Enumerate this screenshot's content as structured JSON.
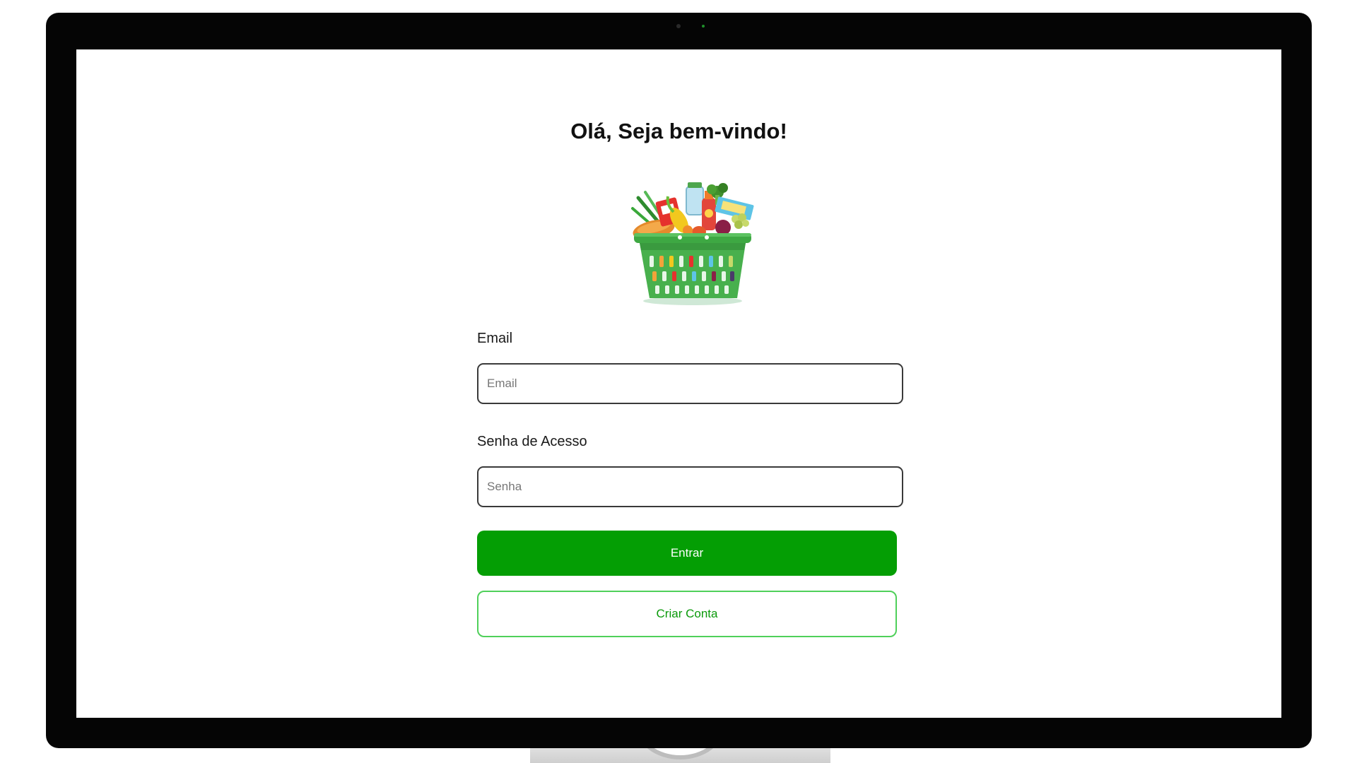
{
  "page": {
    "title": "Olá, Seja bem-vindo!",
    "logo_icon": "grocery-basket-icon"
  },
  "form": {
    "email": {
      "label": "Email",
      "placeholder": "Email",
      "value": ""
    },
    "password": {
      "label": "Senha de Acesso",
      "placeholder": "Senha",
      "value": ""
    },
    "submit_label": "Entrar",
    "create_account_label": "Criar Conta"
  },
  "colors": {
    "primary": "#049e04",
    "secondary_text": "#0b9a0b",
    "secondary_border": "#4fd05a",
    "input_border": "#3a3a3a",
    "bezel": "#050505"
  }
}
